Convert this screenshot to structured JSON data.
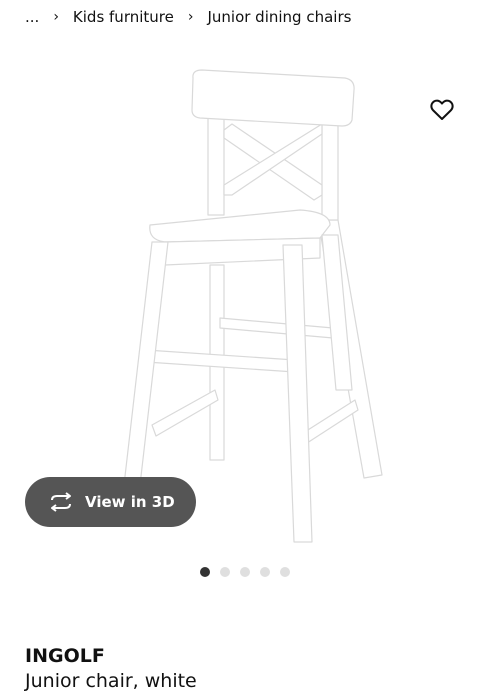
{
  "breadcrumb": {
    "items": [
      "...",
      "Kids furniture",
      "Junior dining chairs"
    ],
    "separator": "›"
  },
  "favorite": {
    "icon": "heart-outline-icon"
  },
  "view_3d": {
    "label": "View in 3D",
    "icon": "rotate-3d-icon"
  },
  "carousel": {
    "total": 5,
    "active_index": 0
  },
  "product": {
    "name": "INGOLF",
    "description": "Junior chair, white"
  },
  "colors": {
    "button_bg": "#555555",
    "dot_active": "#333333",
    "dot_inactive": "#dfdfdf"
  }
}
